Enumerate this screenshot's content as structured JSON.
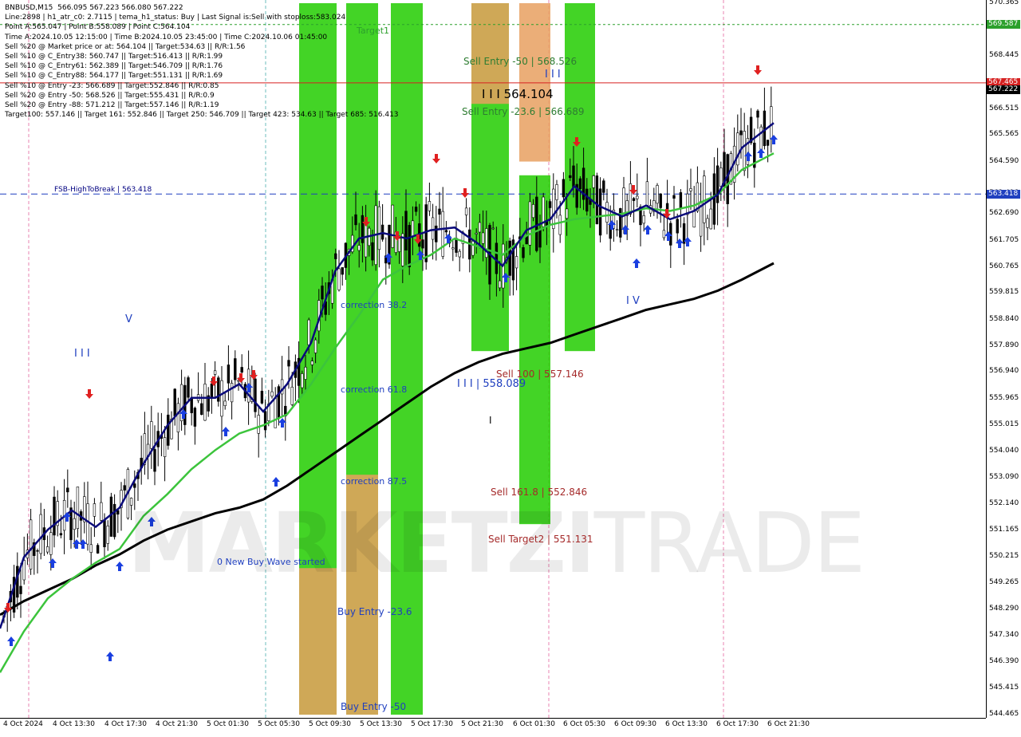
{
  "info_lines": [
    "BNBUSD,M15  566.095 567.223 566.080 567.222",
    "Line:2898 | h1_atr_c0: 2.7115 | tema_h1_status: Buy | Last Signal is:Sell with stoploss:583.024",
    "Point A:565.047 | Point B:558.089 | Point C:564.104",
    "Time A:2024.10.05 12:15:00 | Time B:2024.10.05 23:45:00 | Time C:2024.10.06 01:45:00",
    "Sell %20 @ Market price or at: 564.104 || Target:534.63 || R/R:1.56",
    "Sell %10 @ C_Entry38: 560.747 || Target:516.413 || R/R:1.99",
    "Sell %10 @ C_Entry61: 562.389 || Target:546.709 || R/R:1.76",
    "Sell %10 @ C_Entry88: 564.177 || Target:551.131 || R/R:1.69",
    "Sell %10 @ Entry -23: 566.689 || Target:552.846 || R/R:0.85",
    "Sell %20 @ Entry -50: 568.526 || Target:555.431 || R/R:0.9",
    "Sell %20 @ Entry -88: 571.212 || Target:557.146 || R/R:1.19",
    "Target100: 557.146 || Target 161: 552.846 || Target 250: 546.709 || Target 423: 534.63 || Target 685: 516.413"
  ],
  "watermark": {
    "bold": "MARKETZI",
    "thin": "TRADE"
  },
  "y_ticks": [
    "570.365",
    "569.587",
    "568.445",
    "567.465",
    "566.515",
    "565.565",
    "564.590",
    "563.418",
    "562.690",
    "561.705",
    "560.765",
    "559.815",
    "558.840",
    "557.890",
    "556.940",
    "555.965",
    "555.015",
    "554.040",
    "553.090",
    "552.140",
    "551.165",
    "550.215",
    "549.265",
    "548.290",
    "547.340",
    "546.390",
    "545.415",
    "544.465"
  ],
  "x_ticks": [
    "4 Oct 2024",
    "4 Oct 13:30",
    "4 Oct 17:30",
    "4 Oct 21:30",
    "5 Oct 01:30",
    "5 Oct 05:30",
    "5 Oct 09:30",
    "5 Oct 13:30",
    "5 Oct 17:30",
    "5 Oct 21:30",
    "6 Oct 01:30",
    "6 Oct 05:30",
    "6 Oct 09:30",
    "6 Oct 13:30",
    "6 Oct 17:30",
    "6 Oct 21:30"
  ],
  "price_tags": [
    {
      "value": "569.587",
      "color": "#2ca02c"
    },
    {
      "value": "567.465",
      "color": "#d62020"
    },
    {
      "value": "567.222",
      "color": "#000000"
    },
    {
      "value": "563.418",
      "color": "#1f3fbf"
    }
  ],
  "annotations": [
    {
      "text": "Target1",
      "color": "#2ca02c"
    },
    {
      "text": "Sell Entry -50 | 568.526",
      "color": "#2e7d32"
    },
    {
      "text": "I I I",
      "color": "#1f3fbf"
    },
    {
      "text": "I I I 564.104",
      "color": "#000000"
    },
    {
      "text": "Sell Entry -23.6 | 566.689",
      "color": "#2e7d32"
    },
    {
      "text": "FSB-HighToBreak | 563.418",
      "color": "#000080"
    },
    {
      "text": "correction 38.2",
      "color": "#1f3fbf"
    },
    {
      "text": "correction 61.8",
      "color": "#1f3fbf"
    },
    {
      "text": "correction 87.5",
      "color": "#1f3fbf"
    },
    {
      "text": "V",
      "color": "#1f3fbf"
    },
    {
      "text": "I I I",
      "color": "#1f3fbf"
    },
    {
      "text": "I V",
      "color": "#1f3fbf"
    },
    {
      "text": "Sell 100 | 557.146",
      "color": "#a52a2a"
    },
    {
      "text": "I I I | 558.089",
      "color": "#1f3fbf"
    },
    {
      "text": "I",
      "color": "#000000"
    },
    {
      "text": "Sell 161.8 | 552.846",
      "color": "#a52a2a"
    },
    {
      "text": "Sell Target2 | 551.131",
      "color": "#a52a2a"
    },
    {
      "text": "0 New Buy Wave started",
      "color": "#1f3fbf"
    },
    {
      "text": "Buy Entry -23.6",
      "color": "#1f3fbf"
    },
    {
      "text": "Buy Entry -50",
      "color": "#1f3fbf"
    }
  ],
  "chart_data": {
    "type": "candlestick",
    "symbol": "BNBUSD,M15",
    "ylim": [
      544.465,
      570.365
    ],
    "x_start": "4 Oct 2024",
    "x_end": "6 Oct 21:30",
    "horizontal_lines": [
      {
        "value": 569.587,
        "style": "dashed",
        "color": "#2ca02c"
      },
      {
        "value": 567.465,
        "style": "solid",
        "color": "#d62020"
      },
      {
        "value": 563.418,
        "style": "dashed",
        "color": "#1f3fbf"
      }
    ],
    "ma_series": [
      {
        "color": "#000000",
        "points": [
          [
            0,
            548.1
          ],
          [
            30,
            548.6
          ],
          [
            60,
            549.0
          ],
          [
            90,
            549.4
          ],
          [
            120,
            549.9
          ],
          [
            150,
            550.3
          ],
          [
            180,
            550.8
          ],
          [
            210,
            551.2
          ],
          [
            240,
            551.5
          ],
          [
            270,
            551.8
          ],
          [
            300,
            552.0
          ],
          [
            330,
            552.3
          ],
          [
            360,
            552.8
          ],
          [
            390,
            553.4
          ],
          [
            420,
            554.0
          ],
          [
            450,
            554.6
          ],
          [
            480,
            555.2
          ],
          [
            510,
            555.8
          ],
          [
            540,
            556.4
          ],
          [
            570,
            556.9
          ],
          [
            600,
            557.3
          ],
          [
            630,
            557.6
          ],
          [
            660,
            557.8
          ],
          [
            690,
            558.0
          ],
          [
            720,
            558.3
          ],
          [
            750,
            558.6
          ],
          [
            780,
            558.9
          ],
          [
            810,
            559.2
          ],
          [
            840,
            559.4
          ],
          [
            870,
            559.6
          ],
          [
            900,
            559.9
          ],
          [
            930,
            560.3
          ],
          [
            970,
            560.9
          ]
        ]
      },
      {
        "color": "#3cc43c",
        "points": [
          [
            0,
            546.0
          ],
          [
            30,
            547.5
          ],
          [
            60,
            548.7
          ],
          [
            90,
            549.4
          ],
          [
            120,
            550.0
          ],
          [
            150,
            550.5
          ],
          [
            180,
            551.7
          ],
          [
            210,
            552.5
          ],
          [
            240,
            553.4
          ],
          [
            270,
            554.1
          ],
          [
            300,
            554.7
          ],
          [
            330,
            555.0
          ],
          [
            360,
            555.4
          ],
          [
            390,
            556.5
          ],
          [
            420,
            557.8
          ],
          [
            450,
            559.0
          ],
          [
            480,
            560.3
          ],
          [
            510,
            560.8
          ],
          [
            540,
            561.2
          ],
          [
            570,
            561.8
          ],
          [
            600,
            561.5
          ],
          [
            630,
            561.2
          ],
          [
            660,
            561.9
          ],
          [
            690,
            562.3
          ],
          [
            720,
            562.5
          ],
          [
            750,
            562.6
          ],
          [
            780,
            562.7
          ],
          [
            810,
            562.9
          ],
          [
            840,
            562.8
          ],
          [
            870,
            563.0
          ],
          [
            900,
            563.4
          ],
          [
            930,
            564.3
          ],
          [
            970,
            564.9
          ]
        ]
      },
      {
        "color": "#0a0a7a",
        "points": [
          [
            0,
            547.6
          ],
          [
            30,
            550.2
          ],
          [
            60,
            551.2
          ],
          [
            90,
            551.9
          ],
          [
            120,
            551.3
          ],
          [
            150,
            552.0
          ],
          [
            180,
            553.6
          ],
          [
            210,
            555.0
          ],
          [
            240,
            556.0
          ],
          [
            270,
            556.0
          ],
          [
            300,
            556.5
          ],
          [
            330,
            555.5
          ],
          [
            360,
            556.5
          ],
          [
            390,
            558.0
          ],
          [
            420,
            560.6
          ],
          [
            450,
            561.8
          ],
          [
            480,
            562.0
          ],
          [
            510,
            561.8
          ],
          [
            540,
            562.1
          ],
          [
            570,
            562.2
          ],
          [
            600,
            561.6
          ],
          [
            630,
            560.8
          ],
          [
            660,
            562.1
          ],
          [
            690,
            562.5
          ],
          [
            720,
            563.7
          ],
          [
            750,
            563.0
          ],
          [
            780,
            562.6
          ],
          [
            810,
            563.0
          ],
          [
            840,
            562.5
          ],
          [
            870,
            562.8
          ],
          [
            900,
            563.4
          ],
          [
            930,
            565.1
          ],
          [
            970,
            566.0
          ]
        ]
      }
    ],
    "zones": [
      {
        "color": "#22cc00",
        "from": 375,
        "to": 422,
        "y_top": 570.365,
        "y_bottom": 544.465
      },
      {
        "color": "#22cc00",
        "from": 434,
        "to": 474,
        "y_top": 570.365,
        "y_bottom": 544.465
      },
      {
        "color": "#22cc00",
        "from": 490,
        "to": 530,
        "y_top": 570.365,
        "y_bottom": 544.465
      },
      {
        "color": "#22cc00",
        "from": 591,
        "to": 638,
        "y_top": 570.365,
        "y_bottom": 557.7
      },
      {
        "color": "#22cc00",
        "from": 651,
        "to": 690,
        "y_top": 564.1,
        "y_bottom": 551.4
      },
      {
        "color": "#22cc00",
        "from": 708,
        "to": 746,
        "y_top": 570.365,
        "y_bottom": 557.7
      },
      {
        "color": "#e8a060",
        "from": 375,
        "to": 422,
        "y_top": 549.8,
        "y_bottom": 544.465
      },
      {
        "color": "#e8a060",
        "from": 434,
        "to": 474,
        "y_top": 553.2,
        "y_bottom": 544.465
      },
      {
        "color": "#e8a060",
        "from": 591,
        "to": 638,
        "y_top": 570.365,
        "y_bottom": 566.7
      },
      {
        "color": "#e8a060",
        "from": 651,
        "to": 690,
        "y_top": 570.365,
        "y_bottom": 564.6
      }
    ]
  }
}
